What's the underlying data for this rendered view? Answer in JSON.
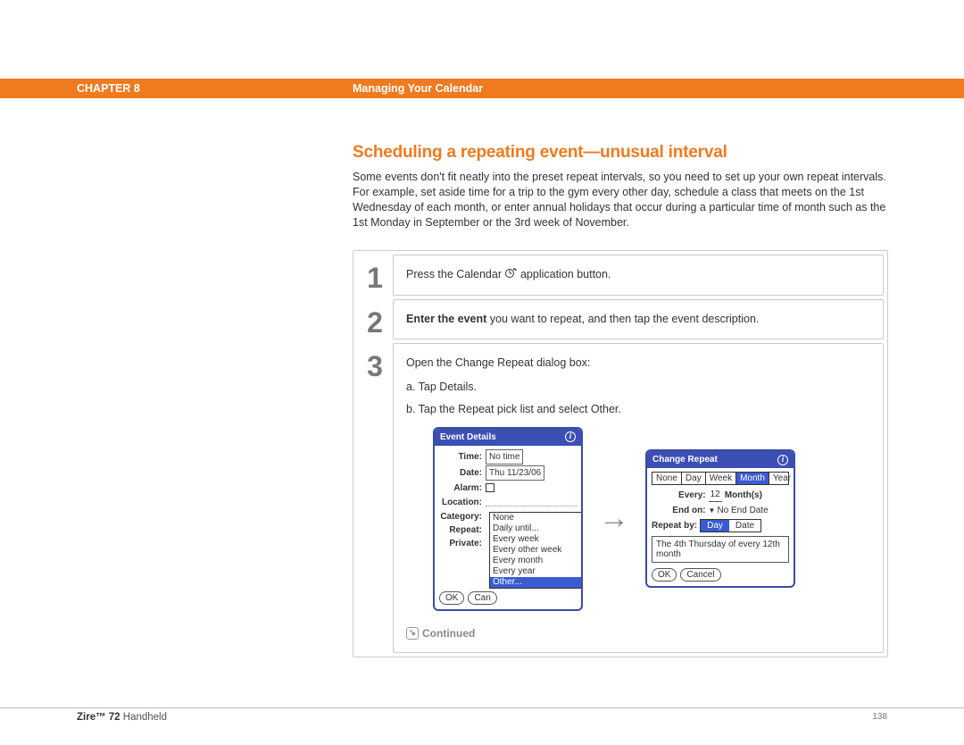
{
  "header": {
    "chapter": "CHAPTER 8",
    "section": "Managing Your Calendar"
  },
  "title": "Scheduling a repeating event—unusual interval",
  "intro": "Some events don't fit neatly into the preset repeat intervals, so you need to set up your own repeat intervals. For example, set aside time for a trip to the gym every other day, schedule a class that meets on the 1st Wednesday of each month, or enter annual holidays that occur during a particular time of month such as the 1st Monday in September or the 3rd week of November.",
  "steps": {
    "n1": "1",
    "n2": "2",
    "n3": "3",
    "s1_a": "Press the Calendar ",
    "s1_b": " application button.",
    "s2_bold": "Enter the event",
    "s2_rest": " you want to repeat, and then tap the event description.",
    "s3_intro": "Open the Change Repeat dialog box:",
    "s3_a": "a.  Tap Details.",
    "s3_b": "b.  Tap the Repeat pick list and select Other."
  },
  "event_details": {
    "title": "Event Details",
    "labels": {
      "time": "Time:",
      "date": "Date:",
      "alarm": "Alarm:",
      "location": "Location:",
      "category": "Category:",
      "repeat": "Repeat:",
      "private": "Private:"
    },
    "values": {
      "time": "No time",
      "date": "Thu 11/23/06"
    },
    "options": {
      "o1": "None",
      "o2": "Daily until...",
      "o3": "Every week",
      "o4": "Every other week",
      "o5": "Every month",
      "o6": "Every year",
      "o7": "Other..."
    },
    "buttons": {
      "ok": "OK",
      "cancel": "Can"
    }
  },
  "change_repeat": {
    "title": "Change Repeat",
    "tabs": {
      "t1": "None",
      "t2": "Day",
      "t3": "Week",
      "t4": "Month",
      "t5": "Year"
    },
    "every_label": "Every:",
    "every_val": "12",
    "every_unit": "Month(s)",
    "endon_label": "End on:",
    "endon_val": "No End Date",
    "repeatby_label": "Repeat by:",
    "seg1": "Day",
    "seg2": "Date",
    "result": "The 4th Thursday of every 12th month",
    "buttons": {
      "ok": "OK",
      "cancel": "Cancel"
    }
  },
  "continued": "Continued",
  "footer": {
    "product_bold": "Zire™ 72",
    "product_rest": " Handheld",
    "page": "138"
  }
}
